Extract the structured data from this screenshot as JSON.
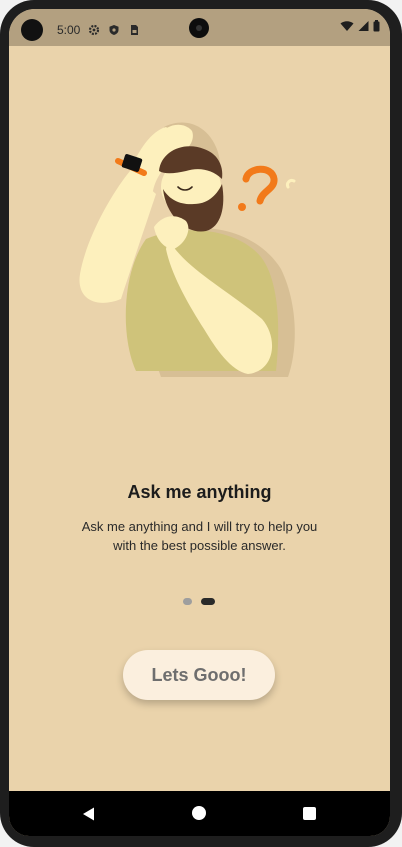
{
  "status_bar": {
    "time": "5:00",
    "left_icons": [
      "camera-cutout-icon",
      "settings-icon",
      "shield-icon",
      "sim-card-icon"
    ],
    "right_icons": [
      "wifi-icon",
      "signal-icon",
      "battery-icon"
    ]
  },
  "onboarding": {
    "illustration": "thinking-man-with-question-mark",
    "title": "Ask me anything",
    "subtitle": "Ask me anything and I will try to help you with the best possible answer.",
    "pager": {
      "current": 2,
      "total": 2
    },
    "cta_label": "Lets Gooo!"
  },
  "nav_bar": {
    "icons": [
      "back-icon",
      "home-icon",
      "recents-icon"
    ]
  },
  "colors": {
    "background": "#ead3ab",
    "status_bar": "#b3a080",
    "accent": "#f27a1a",
    "button_bg": "#fbefde",
    "button_text": "#6e6e6e"
  }
}
